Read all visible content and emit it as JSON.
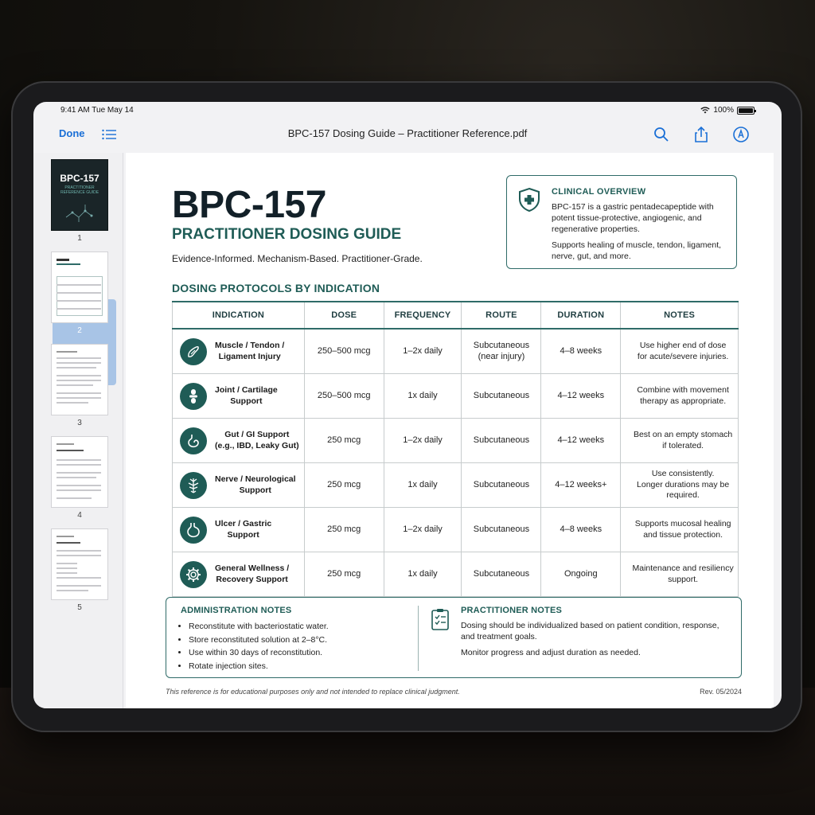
{
  "status": {
    "time": "9:41 AM   Tue May 14",
    "battery": "100%"
  },
  "toolbar": {
    "done_label": "Done",
    "document_title": "BPC-157 Dosing Guide – Practitioner Reference.pdf",
    "icons": [
      "list-icon",
      "search-icon",
      "share-icon",
      "markup-icon"
    ]
  },
  "sidebar": {
    "pages": [
      {
        "number": "1",
        "cover_title": "BPC-157",
        "cover_subtitle": "PRACTITIONER REFERENCE GUIDE"
      },
      {
        "number": "2",
        "selected": true
      },
      {
        "number": "3"
      },
      {
        "number": "4"
      },
      {
        "number": "5"
      }
    ]
  },
  "page": {
    "title": "BPC-157",
    "subtitle": "PRACTITIONER DOSING GUIDE",
    "tagline": "Evidence-Informed. Mechanism-Based. Practitioner-Grade.",
    "overview": {
      "heading": "CLINICAL OVERVIEW",
      "p1": "BPC-157 is a gastric pentadecapeptide with potent tissue-protective, angiogenic, and regenerative properties.",
      "p2": "Supports healing of muscle, tendon, ligament, nerve, gut, and more."
    },
    "section_heading": "DOSING PROTOCOLS BY INDICATION",
    "columns": [
      "INDICATION",
      "DOSE",
      "FREQUENCY",
      "ROUTE",
      "DURATION",
      "NOTES"
    ],
    "rows": [
      {
        "icon": "muscle-icon",
        "indication_1": "Muscle / Tendon /",
        "indication_2": "Ligament Injury",
        "dose": "250–500 mcg",
        "frequency": "1–2x daily",
        "route_1": "Subcutaneous",
        "route_2": "(near injury)",
        "duration": "4–8 weeks",
        "notes_1": "Use higher end of dose",
        "notes_2": "for acute/severe injuries."
      },
      {
        "icon": "joint-icon",
        "indication_1": "Joint / Cartilage",
        "indication_2": "Support",
        "dose": "250–500 mcg",
        "frequency": "1x daily",
        "route_1": "Subcutaneous",
        "route_2": "",
        "duration": "4–12 weeks",
        "notes_1": "Combine with movement",
        "notes_2": "therapy as appropriate."
      },
      {
        "icon": "gut-icon",
        "indication_1": "Gut / GI Support",
        "indication_2": "(e.g., IBD, Leaky Gut)",
        "dose": "250 mcg",
        "frequency": "1–2x daily",
        "route_1": "Subcutaneous",
        "route_2": "",
        "duration": "4–12 weeks",
        "notes_1": "Best on an empty stomach",
        "notes_2": "if tolerated."
      },
      {
        "icon": "nerve-icon",
        "indication_1": "Nerve / Neurological",
        "indication_2": "Support",
        "dose": "250 mcg",
        "frequency": "1x daily",
        "route_1": "Subcutaneous",
        "route_2": "",
        "duration": "4–12 weeks+",
        "notes_1": "Use consistently.",
        "notes_2": "Longer durations may be required."
      },
      {
        "icon": "stomach-icon",
        "indication_1": "Ulcer / Gastric",
        "indication_2": "Support",
        "dose": "250 mcg",
        "frequency": "1–2x daily",
        "route_1": "Subcutaneous",
        "route_2": "",
        "duration": "4–8 weeks",
        "notes_1": "Supports mucosal healing",
        "notes_2": "and tissue protection."
      },
      {
        "icon": "gear-icon",
        "indication_1": "General Wellness /",
        "indication_2": "Recovery Support",
        "dose": "250 mcg",
        "frequency": "1x daily",
        "route_1": "Subcutaneous",
        "route_2": "",
        "duration": "Ongoing",
        "notes_1": "Maintenance and resiliency",
        "notes_2": "support."
      }
    ],
    "admin_notes": {
      "heading": "ADMINISTRATION NOTES",
      "items": [
        "Reconstitute with bacteriostatic water.",
        "Store reconstituted solution at 2–8°C.",
        "Use within 30 days of reconstitution.",
        "Rotate injection sites."
      ]
    },
    "practitioner_notes": {
      "heading": "PRACTITIONER NOTES",
      "p1": "Dosing should be individualized based on patient condition, response, and treatment goals.",
      "p2": "Monitor progress and adjust duration as needed."
    },
    "disclaimer": "This reference is for educational purposes only and not intended to replace clinical judgment.",
    "revision": "Rev. 05/2024"
  },
  "colors": {
    "accent": "#1f5c56",
    "link": "#1a6fd6",
    "title": "#122028"
  }
}
